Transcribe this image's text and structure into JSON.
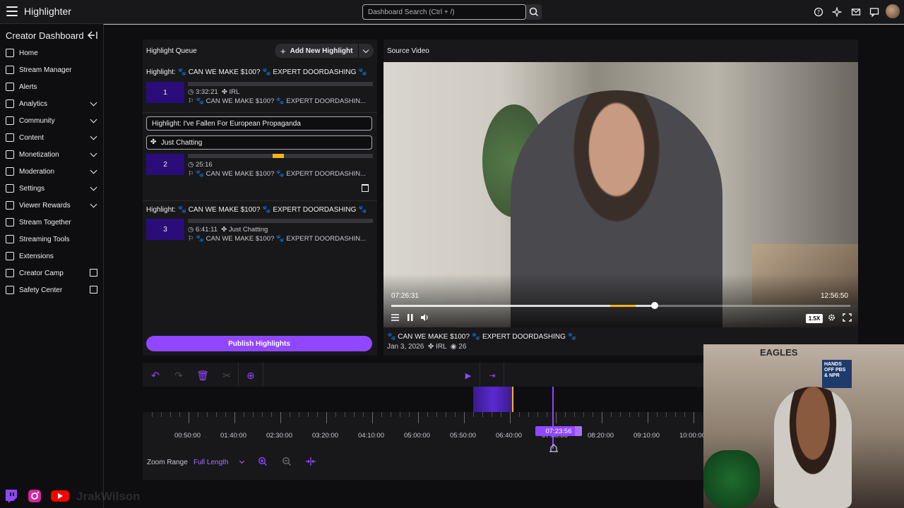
{
  "app": {
    "title": "Highlighter",
    "search_placeholder": "Dashboard Search (Ctrl + /)"
  },
  "sidebar": {
    "title": "Creator Dashboard",
    "items": [
      {
        "label": "Home",
        "icon": "home-icon",
        "expandable": false,
        "external": false
      },
      {
        "label": "Stream Manager",
        "icon": "stream-manager-icon",
        "expandable": false,
        "external": false
      },
      {
        "label": "Alerts",
        "icon": "alerts-icon",
        "expandable": false,
        "external": false
      },
      {
        "label": "Analytics",
        "icon": "analytics-icon",
        "expandable": true,
        "external": false
      },
      {
        "label": "Community",
        "icon": "community-icon",
        "expandable": true,
        "external": false
      },
      {
        "label": "Content",
        "icon": "content-icon",
        "expandable": true,
        "external": false
      },
      {
        "label": "Monetization",
        "icon": "monetization-icon",
        "expandable": true,
        "external": false
      },
      {
        "label": "Moderation",
        "icon": "moderation-icon",
        "expandable": true,
        "external": false
      },
      {
        "label": "Settings",
        "icon": "settings-icon",
        "expandable": true,
        "external": false
      },
      {
        "label": "Viewer Rewards",
        "icon": "viewer-rewards-icon",
        "expandable": true,
        "external": false
      },
      {
        "label": "Stream Together",
        "icon": "stream-together-icon",
        "expandable": false,
        "external": false
      },
      {
        "label": "Streaming Tools",
        "icon": "streaming-tools-icon",
        "expandable": false,
        "external": false
      },
      {
        "label": "Extensions",
        "icon": "extensions-icon",
        "expandable": false,
        "external": false
      },
      {
        "label": "Creator Camp",
        "icon": "creator-camp-icon",
        "expandable": false,
        "external": true
      },
      {
        "label": "Safety Center",
        "icon": "safety-center-icon",
        "expandable": false,
        "external": true
      }
    ]
  },
  "queue": {
    "title": "Highlight Queue",
    "add_button": "Add New Highlight",
    "publish_button": "Publish Highlights",
    "items": [
      {
        "title": "Highlight: 🐾 CAN WE MAKE $100? 🐾 EXPERT DOORDASHING 🐾",
        "number": "1",
        "duration": "3:32:21",
        "category": "IRL",
        "source": "🐾 CAN WE MAKE $100? 🐾 EXPERT DOORDASHIN..."
      },
      {
        "title": "Highlight: I've Fallen For European Propaganda",
        "number": "2",
        "duration": "25:16",
        "category": "Just Chatting",
        "source": "🐾 CAN WE MAKE $100? 🐾 EXPERT DOORDASHIN..."
      },
      {
        "title": "Highlight: 🐾 CAN WE MAKE $100? 🐾 EXPERT DOORDASHING 🐾",
        "number": "3",
        "duration": "6:41:11",
        "category": "Just Chatting",
        "source": "🐾 CAN WE MAKE $100? 🐾 EXPERT DOORDASHIN..."
      }
    ]
  },
  "source_video": {
    "title": "Source Video",
    "current_time": "07:26:31",
    "total_time": "12:56:50",
    "speed": "1.5X",
    "stream_title": "🐾 CAN WE MAKE $100? 🐾 EXPERT DOORDASHING 🐾",
    "date": "Jan 3, 2026",
    "category": "IRL",
    "views": "26",
    "progress_fraction": 0.574
  },
  "timeline": {
    "ticks": [
      "00:50:00",
      "01:40:00",
      "02:30:00",
      "03:20:00",
      "04:10:00",
      "05:00:00",
      "05:50:00",
      "06:40:00",
      "07:30:00",
      "08:20:00",
      "09:10:00",
      "10:00:00"
    ],
    "playhead": "07:23:56",
    "zoom_label": "Zoom Range",
    "zoom_value": "Full Length"
  },
  "colors": {
    "accent": "#9147ff",
    "highlight": "#f3b51b",
    "badge": "#2a0d78"
  },
  "footer": {
    "watermark": "JrakWilson"
  }
}
